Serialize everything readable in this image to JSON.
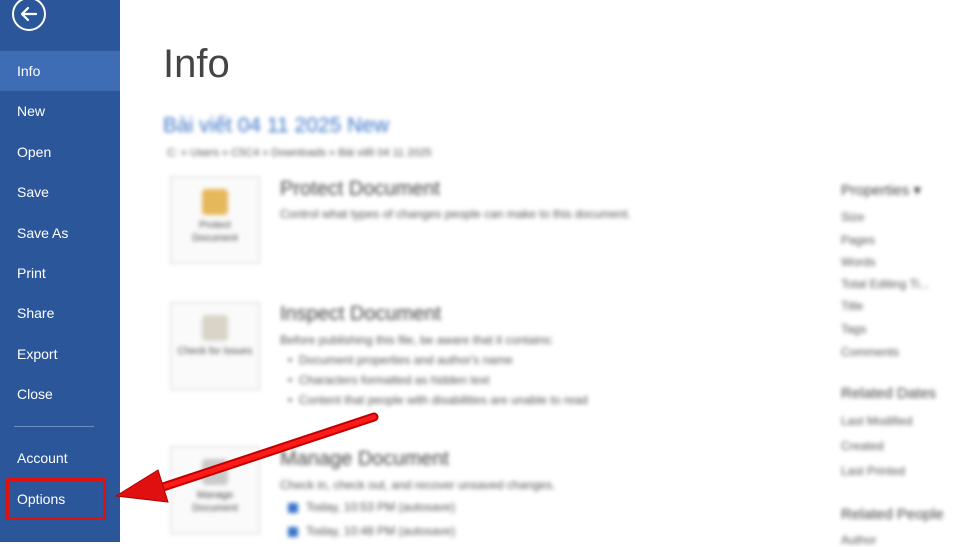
{
  "sidebar": {
    "items": [
      {
        "label": "Info",
        "active": true
      },
      {
        "label": "New"
      },
      {
        "label": "Open"
      },
      {
        "label": "Save"
      },
      {
        "label": "Save As"
      },
      {
        "label": "Print"
      },
      {
        "label": "Share"
      },
      {
        "label": "Export"
      },
      {
        "label": "Close"
      },
      {
        "label": "Account"
      },
      {
        "label": "Options",
        "highlighted": true
      }
    ]
  },
  "main": {
    "title": "Info",
    "doc_name": "Bài viết 04 11 2025 New",
    "doc_path": "C: » Users » C5C4 » Downloads » Bài viết 04 11 2025",
    "sections": [
      {
        "tile_label": "Protect Document",
        "title": "Protect Document",
        "desc": "Control what types of changes people can make to this document."
      },
      {
        "tile_label": "Check for Issues",
        "title": "Inspect Document",
        "desc": "Before publishing this file, be aware that it contains:",
        "bullets": [
          "Document properties and author's name",
          "Characters formatted as hidden text",
          "Content that people with disabilities are unable to read"
        ]
      },
      {
        "tile_label": "Manage Document",
        "title": "Manage Document",
        "desc": "Check in, check out, and recover unsaved changes.",
        "versions": [
          "Today, 10:53 PM (autosave)",
          "Today, 10:48 PM (autosave)"
        ]
      }
    ],
    "properties": {
      "head": "Properties",
      "items": [
        "Size",
        "Pages",
        "Words",
        "Total Editing Ti...",
        "Title",
        "Tags",
        "Comments"
      ],
      "related_dates_head": "Related Dates",
      "dates": [
        "Last Modified",
        "Created",
        "Last Printed"
      ],
      "related_people_head": "Related People",
      "people": [
        "Author"
      ]
    }
  },
  "colors": {
    "sidebar": "#2b579a",
    "sidebar_active": "#3e6db5",
    "annotation": "#e01010"
  }
}
